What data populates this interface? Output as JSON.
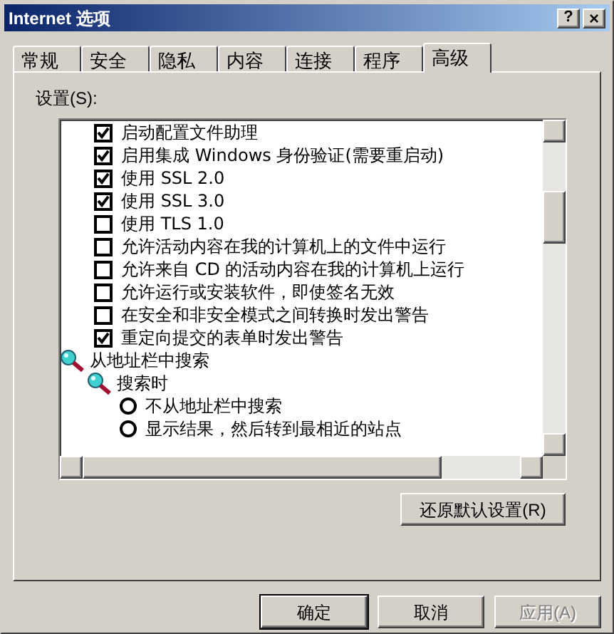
{
  "window": {
    "title": "Internet 选项",
    "help_button": "?",
    "close_button": "×"
  },
  "tabs": [
    {
      "label": "常规",
      "selected": false
    },
    {
      "label": "安全",
      "selected": false
    },
    {
      "label": "隐私",
      "selected": false
    },
    {
      "label": "内容",
      "selected": false
    },
    {
      "label": "连接",
      "selected": false
    },
    {
      "label": "程序",
      "selected": false
    },
    {
      "label": "高级",
      "selected": true
    }
  ],
  "settings_label": "设置(S):",
  "settings": [
    {
      "kind": "checkbox",
      "label": "启动配置文件助理",
      "checked": true
    },
    {
      "kind": "checkbox",
      "label": "启用集成 Windows 身份验证(需要重启动)",
      "checked": true
    },
    {
      "kind": "checkbox",
      "label": "使用 SSL 2.0",
      "checked": true
    },
    {
      "kind": "checkbox",
      "label": "使用 SSL 3.0",
      "checked": true
    },
    {
      "kind": "checkbox",
      "label": "使用 TLS 1.0",
      "checked": false
    },
    {
      "kind": "checkbox",
      "label": "允许活动内容在我的计算机上的文件中运行",
      "checked": false
    },
    {
      "kind": "checkbox",
      "label": "允许来自 CD 的活动内容在我的计算机上运行",
      "checked": false
    },
    {
      "kind": "checkbox",
      "label": "允许运行或安装软件，即使签名无效",
      "checked": false
    },
    {
      "kind": "checkbox",
      "label": "在安全和非安全模式之间转换时发出警告",
      "checked": false
    },
    {
      "kind": "checkbox",
      "label": "重定向提交的表单时发出警告",
      "checked": true
    },
    {
      "kind": "group",
      "label": "从地址栏中搜索",
      "children": [
        {
          "kind": "group",
          "label": "搜索时",
          "children": [
            {
              "kind": "radio",
              "label": "不从地址栏中搜索",
              "selected": false
            },
            {
              "kind": "radio",
              "label": "显示结果，然后转到最相近的站点",
              "selected": false
            }
          ]
        }
      ]
    }
  ],
  "restore_button": "还原默认设置(R)",
  "buttons": [
    {
      "label": "确定",
      "default": true,
      "disabled": false
    },
    {
      "label": "取消",
      "default": false,
      "disabled": false
    },
    {
      "label": "应用(A)",
      "default": false,
      "disabled": true
    }
  ]
}
